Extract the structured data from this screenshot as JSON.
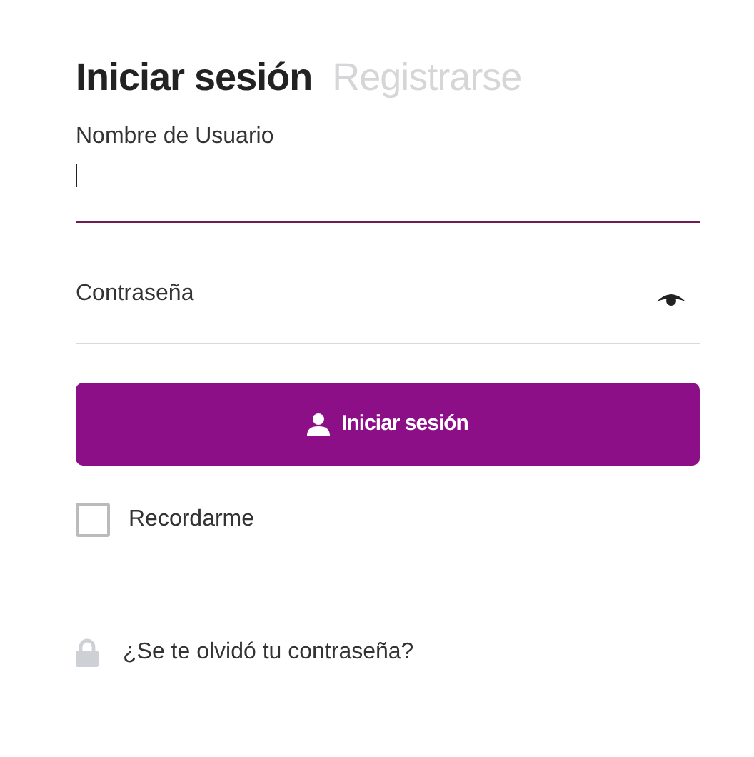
{
  "tabs": [
    {
      "label": "Iniciar sesión",
      "selected": true
    },
    {
      "label": "Registrarse",
      "selected": false
    }
  ],
  "username": {
    "label": "Nombre de Usuario",
    "focused": true
  },
  "password": {
    "placeholder": "Contraseña"
  },
  "submit": {
    "label": "Iniciar sesión"
  },
  "remember": {
    "label": "Recordarme",
    "checked": false
  },
  "forgot": {
    "label": "¿Se te olvidó tu contraseña?"
  }
}
